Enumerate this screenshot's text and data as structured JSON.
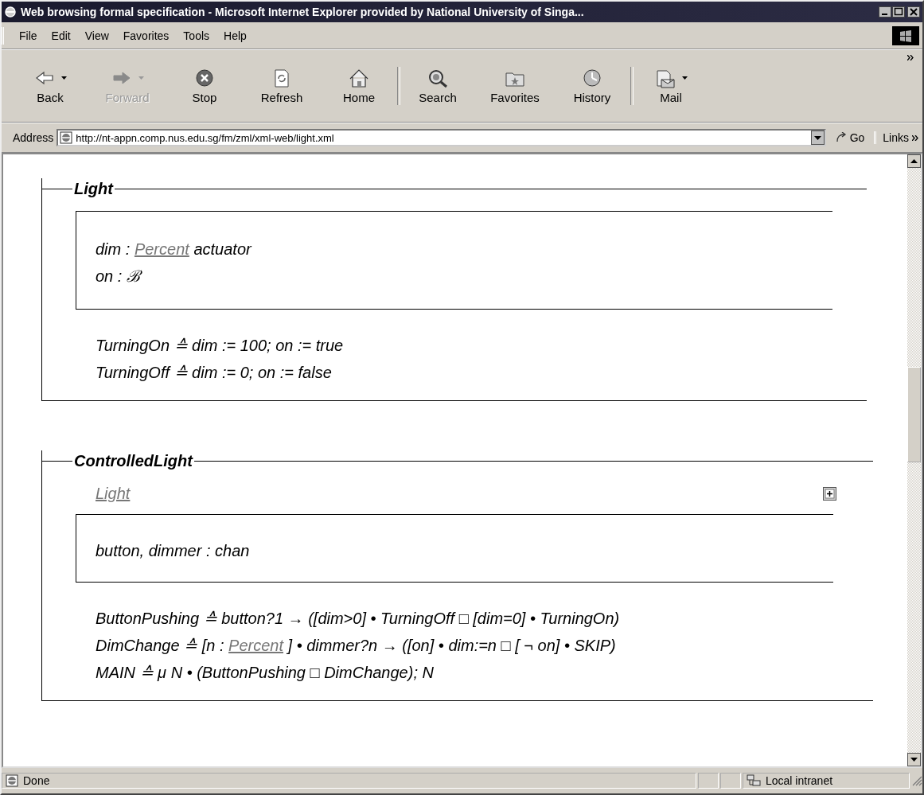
{
  "window": {
    "title": "Web browsing formal specification - Microsoft Internet Explorer provided by National University of Singa..."
  },
  "menu": [
    "File",
    "Edit",
    "View",
    "Favorites",
    "Tools",
    "Help"
  ],
  "toolbar": [
    {
      "label": "Back",
      "kind": "back",
      "disabled": false,
      "dropdown": true
    },
    {
      "label": "Forward",
      "kind": "forward",
      "disabled": true,
      "dropdown": true
    },
    {
      "label": "Stop",
      "kind": "stop",
      "disabled": false
    },
    {
      "label": "Refresh",
      "kind": "refresh",
      "disabled": false
    },
    {
      "label": "Home",
      "kind": "home",
      "disabled": false
    },
    {
      "label": "Search",
      "kind": "search",
      "disabled": false
    },
    {
      "label": "Favorites",
      "kind": "favorites",
      "disabled": false
    },
    {
      "label": "History",
      "kind": "history",
      "disabled": false
    },
    {
      "label": "Mail",
      "kind": "mail",
      "disabled": false,
      "dropdown": true
    }
  ],
  "address": {
    "label": "Address",
    "value": "http://nt-appn.comp.nus.edu.sg/fm/zml/xml-web/light.xml",
    "go": "Go",
    "links": "Links"
  },
  "schemas": [
    {
      "title": "Light",
      "state": [
        [
          {
            "kind": "text",
            "text": "dim : "
          },
          {
            "kind": "link",
            "text": "Percent"
          },
          {
            "kind": "text",
            "text": " actuator"
          }
        ],
        [
          {
            "kind": "text",
            "text": "on : ℬ"
          }
        ]
      ],
      "operations": [
        [
          {
            "kind": "text",
            "text": "TurningOn ≙ dim := 100; on := true"
          }
        ],
        [
          {
            "kind": "text",
            "text": "TurningOff ≙ dim := 0; on := false"
          }
        ]
      ]
    },
    {
      "title": "ControlledLight",
      "includes": [
        "Light"
      ],
      "expandable": true,
      "state": [
        [
          {
            "kind": "text",
            "text": "button, dimmer : chan"
          }
        ]
      ],
      "operations": [
        [
          {
            "kind": "text",
            "text": "ButtonPushing ≙ button?1 → ([dim>0] • TurningOff □ [dim=0] • TurningOn)"
          }
        ],
        [
          {
            "kind": "text",
            "text": "DimChange ≙ [n : "
          },
          {
            "kind": "link",
            "text": "Percent"
          },
          {
            "kind": "text",
            "text": " ] • dimmer?n → ([on] • dim:=n □ [ ¬ on] • SKIP)"
          }
        ],
        [
          {
            "kind": "text",
            "text": "MAIN ≙ μ N • (ButtonPushing □ DimChange); N"
          }
        ]
      ]
    }
  ],
  "status": {
    "text": "Done",
    "zone": "Local intranet"
  }
}
